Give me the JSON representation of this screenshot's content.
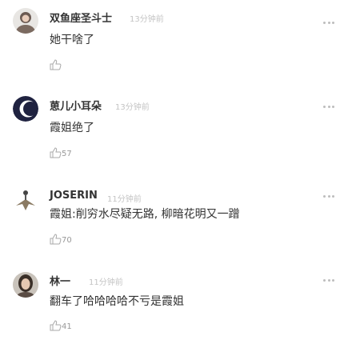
{
  "comments": [
    {
      "name": "双鱼座圣斗士",
      "time": "13分钟前",
      "text": "她干啥了",
      "likes": ""
    },
    {
      "name": "葸儿小耳朵",
      "time": "13分钟前",
      "text": "霞姐绝了",
      "likes": "57"
    },
    {
      "name": "JOSERIN",
      "time": "11分钟前",
      "text": "霞姐:削穷水尽疑无路, 柳暗花明又一蹭",
      "likes": "70"
    },
    {
      "name": "林一",
      "time": "11分钟前",
      "text": "翻车了哈哈哈哈不亏是霞姐",
      "likes": "41"
    }
  ],
  "icons": {
    "like": "thumbs-up-icon",
    "more": "more-dots-icon"
  }
}
